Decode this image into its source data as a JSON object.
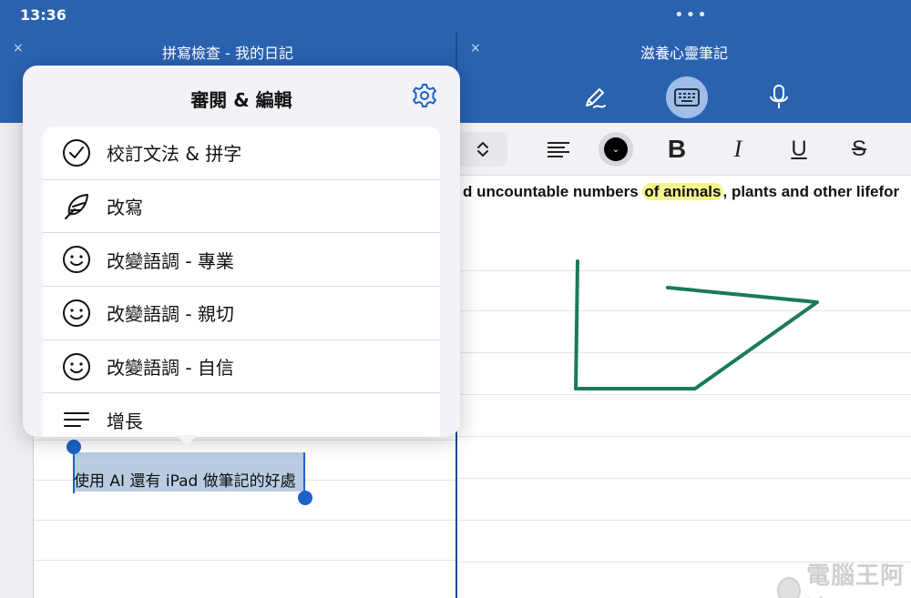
{
  "status": {
    "time": "13:36",
    "multitask": "•••"
  },
  "left_window": {
    "close": "×",
    "title": "拼寫檢查 - 我的日記"
  },
  "right_window": {
    "close": "×",
    "title": "滋養心靈筆記",
    "tools": [
      {
        "name": "pen-icon",
        "active": false
      },
      {
        "name": "keyboard-icon",
        "active": true
      },
      {
        "name": "microphone-icon",
        "active": false
      }
    ],
    "format_bar": {
      "stepper": "⌃⌄",
      "bold": "B",
      "italic": "I",
      "underline": "U",
      "strike": "S",
      "color_chevron": "⌄"
    },
    "note": {
      "text_before": "d uncountable numbers ",
      "highlight": "of animals",
      "text_after": ", plants and other lifefor"
    }
  },
  "popover": {
    "title": "審閱 & 編輯",
    "items": [
      {
        "icon": "check-circle-icon",
        "label": "校訂文法 & 拼字"
      },
      {
        "icon": "feather-icon",
        "label": "改寫"
      },
      {
        "icon": "smiley-icon",
        "label": "改變語調 - 專業"
      },
      {
        "icon": "smiley-icon",
        "label": "改變語調 - 親切"
      },
      {
        "icon": "smiley-icon",
        "label": "改變語調 - 自信"
      },
      {
        "icon": "lines-icon",
        "label": "增長"
      }
    ]
  },
  "selection": {
    "text": "使用 AI 還有 iPad 做筆記的好處"
  },
  "watermark": {
    "text": "電腦王阿達"
  },
  "colors": {
    "accent": "#2a62b0",
    "ink": "#1a7a5a",
    "selection": "#b8cde2",
    "handle": "#1c63c7"
  }
}
